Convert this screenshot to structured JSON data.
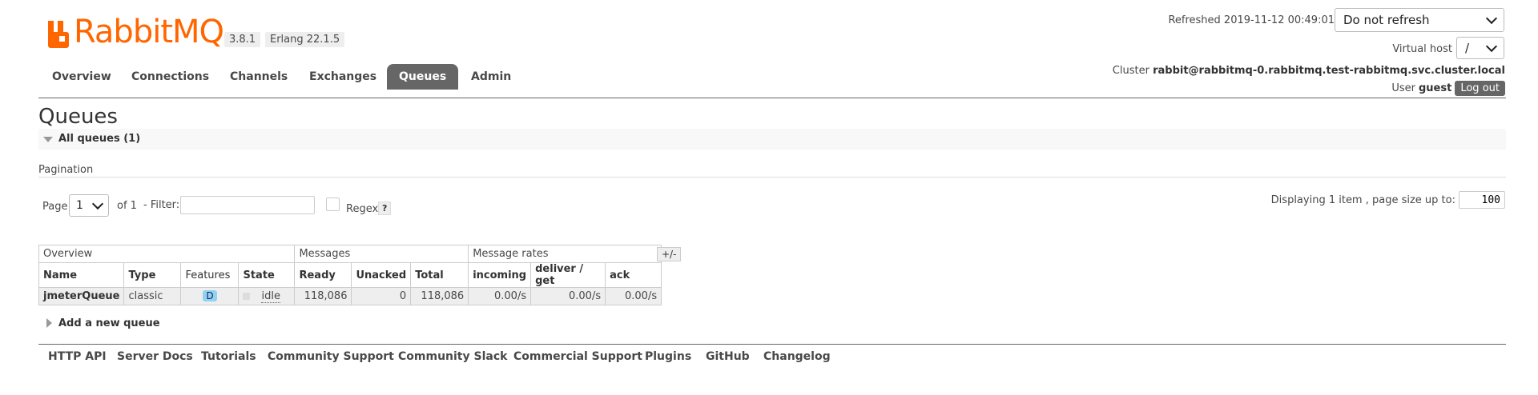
{
  "header": {
    "brand": "RabbitMQ",
    "trademark": "™",
    "version": "3.8.1",
    "erlang": "Erlang 22.1.5",
    "refreshed_label": "Refreshed 2019-11-12 00:49:01",
    "refresh_select": "Do not refresh",
    "vhost_label": "Virtual host",
    "vhost_select": "/",
    "cluster_label": "Cluster",
    "cluster_name": "rabbit@rabbitmq-0.rabbitmq.test-rabbitmq.svc.cluster.local",
    "user_label": "User",
    "user_name": "guest",
    "logout": "Log out"
  },
  "tabs": [
    {
      "label": "Overview"
    },
    {
      "label": "Connections"
    },
    {
      "label": "Channels"
    },
    {
      "label": "Exchanges"
    },
    {
      "label": "Queues",
      "active": true
    },
    {
      "label": "Admin"
    }
  ],
  "page": {
    "title": "Queues",
    "section_title": "All queues (1)",
    "pagination_label": "Pagination",
    "page_label": "Page",
    "page_value": "1",
    "of_label": "of 1",
    "filter_label": "- Filter:",
    "filter_value": "",
    "regex_label": "Regex",
    "help": "?",
    "displaying": "Displaying 1 item , page size up to:",
    "page_size": "100"
  },
  "table": {
    "groups": [
      "Overview",
      "Messages",
      "Message rates"
    ],
    "plus_minus": "+/-",
    "columns": [
      "Name",
      "Type",
      "Features",
      "State",
      "Ready",
      "Unacked",
      "Total",
      "incoming",
      "deliver / get",
      "ack"
    ],
    "rows": [
      {
        "name": "jmeterQueue",
        "type": "classic",
        "features": "D",
        "state": "idle",
        "ready": "118,086",
        "unacked": "0",
        "total": "118,086",
        "incoming": "0.00/s",
        "deliver_get": "0.00/s",
        "ack": "0.00/s"
      }
    ]
  },
  "add_queue": "Add a new queue",
  "footer": [
    "HTTP API",
    "Server Docs",
    "Tutorials",
    "Community Support",
    "Community Slack",
    "Commercial Support",
    "Plugins",
    "GitHub",
    "Changelog"
  ],
  "colors": {
    "brand": "#ff6600",
    "tab_active": "#666666"
  }
}
